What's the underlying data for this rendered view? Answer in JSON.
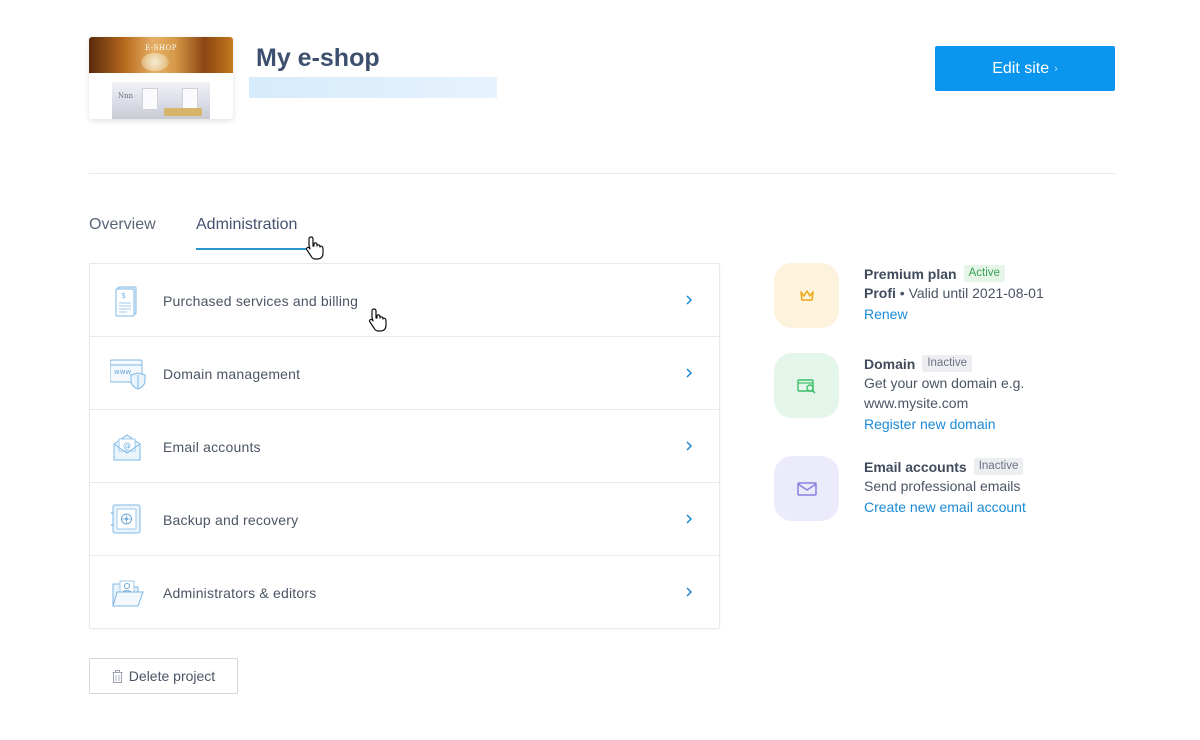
{
  "header": {
    "site_title": "My e-shop",
    "thumbnail_logo_text": "E-SHOP",
    "thumbnail_room_text": "Nnn",
    "edit_button_label": "Edit site"
  },
  "tabs": [
    {
      "label": "Overview",
      "active": false
    },
    {
      "label": "Administration",
      "active": true
    }
  ],
  "admin_items": [
    {
      "label": "Purchased services and billing",
      "icon": "invoice-icon"
    },
    {
      "label": "Domain management",
      "icon": "www-shield-icon"
    },
    {
      "label": "Email accounts",
      "icon": "envelope-at-icon"
    },
    {
      "label": "Backup and recovery",
      "icon": "safe-icon"
    },
    {
      "label": "Administrators & editors",
      "icon": "folder-user-icon"
    }
  ],
  "status": {
    "plan": {
      "title": "Premium plan",
      "badge": "Active",
      "plan_name": "Profi",
      "validity": " • Valid until 2021-08-01",
      "link": "Renew",
      "icon": "crown-icon",
      "color": "#fdf2dc"
    },
    "domain": {
      "title": "Domain",
      "badge": "Inactive",
      "text_line1": "Get your own domain e.g.",
      "text_line2": "www.mysite.com",
      "link": "Register new domain",
      "icon": "domain-search-icon",
      "color": "#e4f6ea"
    },
    "email": {
      "title": "Email accounts",
      "badge": "Inactive",
      "text": "Send professional emails",
      "link": "Create new email account",
      "icon": "envelope-icon",
      "color": "#ecebfb"
    }
  },
  "footer": {
    "delete_label": "Delete project"
  },
  "colors": {
    "primary": "#0a96ee",
    "link": "#1a8ad6",
    "tab_underline": "#2b96cc"
  }
}
